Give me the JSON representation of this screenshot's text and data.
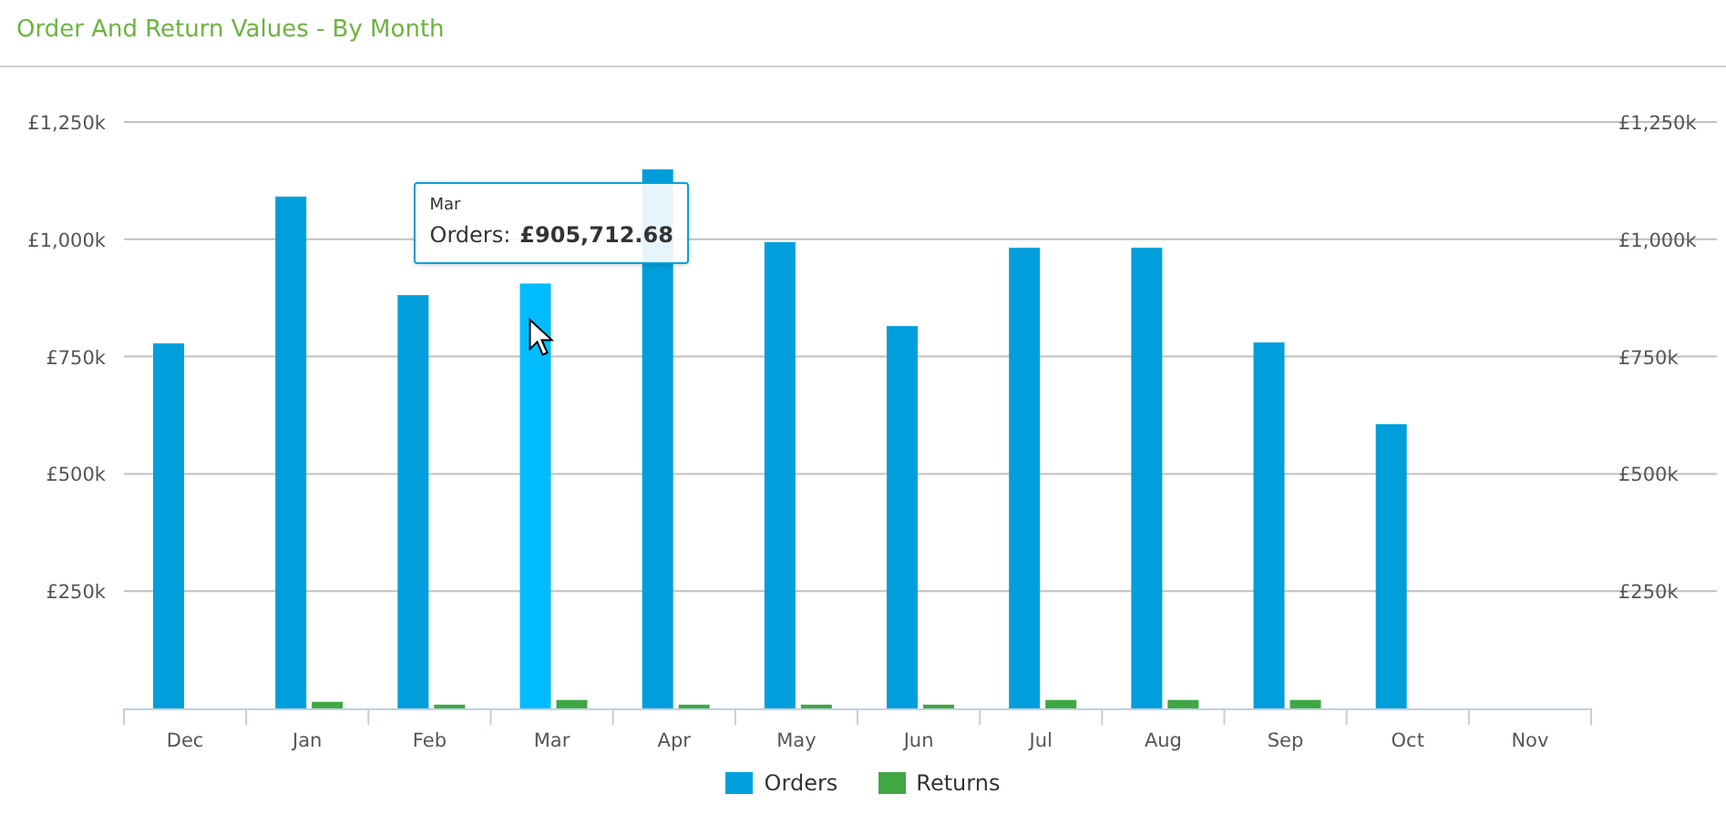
{
  "title": "Order And Return Values - By Month",
  "chart_data": {
    "type": "bar",
    "categories": [
      "Dec",
      "Jan",
      "Feb",
      "Mar",
      "Apr",
      "May",
      "Jun",
      "Jul",
      "Aug",
      "Sep",
      "Oct",
      "Nov"
    ],
    "series": [
      {
        "name": "Orders",
        "color": "#009fdb",
        "values": [
          778,
          1091,
          881,
          905.71,
          1149,
          994,
          815,
          982,
          982,
          780,
          606,
          null
        ]
      },
      {
        "name": "Returns",
        "color": "#3fa845",
        "values": [
          null,
          14,
          8,
          18,
          8,
          8,
          8,
          18,
          18,
          18,
          null,
          null
        ]
      }
    ],
    "ylim": [
      0,
      1250
    ],
    "yticks": [
      {
        "value": 250,
        "label": "£250k"
      },
      {
        "value": 500,
        "label": "£500k"
      },
      {
        "value": 750,
        "label": "£750k"
      },
      {
        "value": 1000,
        "label": "£1,000k"
      },
      {
        "value": 1250,
        "label": "£1,250k"
      }
    ],
    "grid": true
  },
  "hover": [
    {
      "selected": false
    },
    {
      "selected": false
    },
    {
      "selected": false
    },
    {
      "selected": true
    },
    {
      "selected": false
    },
    {
      "selected": false
    },
    {
      "selected": false
    },
    {
      "selected": false
    },
    {
      "selected": false
    },
    {
      "selected": false
    },
    {
      "selected": false
    },
    {
      "selected": false
    }
  ],
  "tooltip": {
    "title": "Mar",
    "label": "Orders:",
    "value": "£905,712.68"
  }
}
